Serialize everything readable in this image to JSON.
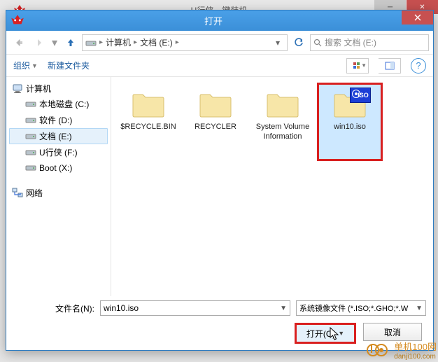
{
  "parent": {
    "title": "U行侠一键装机"
  },
  "dialog": {
    "title": "打开"
  },
  "nav": {
    "breadcrumb": {
      "computer": "计算机",
      "drive": "文档 (E:)"
    },
    "search_placeholder": "搜索 文档 (E:)"
  },
  "toolbar": {
    "organize": "组织",
    "new_folder": "新建文件夹"
  },
  "sidebar": {
    "computer": "计算机",
    "drives": [
      {
        "label": "本地磁盘 (C:)",
        "selected": false
      },
      {
        "label": "软件 (D:)",
        "selected": false
      },
      {
        "label": "文档 (E:)",
        "selected": true
      },
      {
        "label": "U行侠 (F:)",
        "selected": false
      },
      {
        "label": "Boot (X:)",
        "selected": false
      }
    ],
    "network": "网络"
  },
  "items": [
    {
      "name": "$RECYCLE.BIN",
      "type": "folder",
      "selected": false
    },
    {
      "name": "RECYCLER",
      "type": "folder",
      "selected": false
    },
    {
      "name": "System Volume Information",
      "type": "folder",
      "selected": false
    },
    {
      "name": "win10.iso",
      "type": "iso",
      "selected": true
    }
  ],
  "footer": {
    "filename_label": "文件名(N):",
    "filename_value": "win10.iso",
    "filetype": "系统镜像文件 (*.ISO;*.GHO;*.W",
    "open": "打开(O)",
    "cancel": "取消"
  },
  "watermark": {
    "text": "单机100网",
    "url": "danji100.com"
  }
}
